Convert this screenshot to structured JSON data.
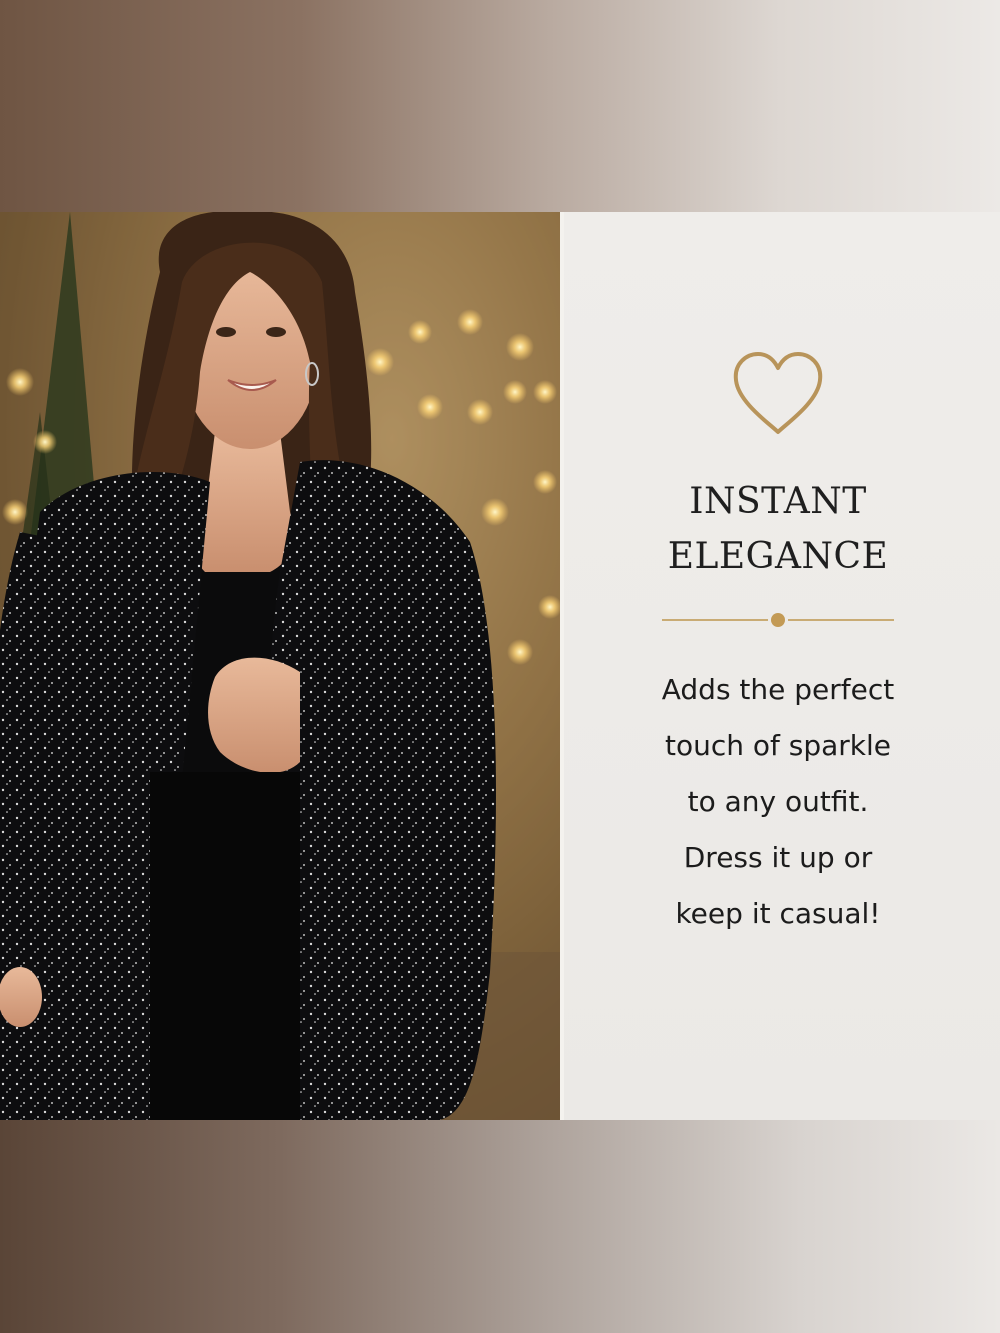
{
  "colors": {
    "accent_gold": "#b8945a",
    "text_dark": "#1f1f1f",
    "panel_bg": "#eceae7"
  },
  "photo": {
    "subject": "woman-in-sparkly-black-cardigan",
    "icon": "photo-image"
  },
  "feature": {
    "icon": "heart-outline-icon",
    "headline_lines": [
      "INSTANT",
      "ELEGANCE"
    ],
    "body_lines": [
      "Adds the perfect",
      "touch of sparkle",
      "to any outfit.",
      "Dress it up or",
      "keep it casual!"
    ]
  }
}
